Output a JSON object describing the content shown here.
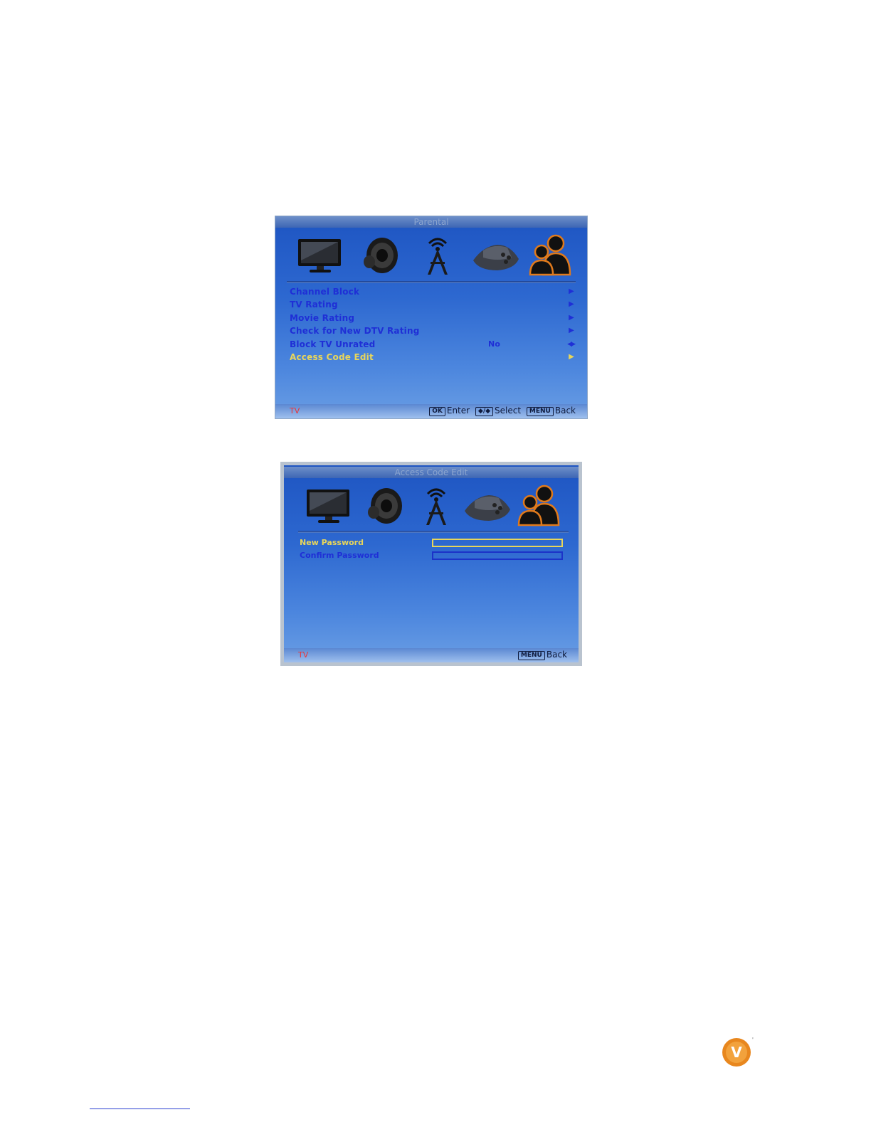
{
  "screen1": {
    "title": "Parental",
    "icons": [
      "tv-picture-icon",
      "speaker-audio-icon",
      "antenna-tower-icon",
      "settings-device-icon",
      "parental-users-icon"
    ],
    "active_icon": "parental-users-icon",
    "menu": [
      {
        "label": "Channel Block",
        "value": "",
        "control": "arrow"
      },
      {
        "label": "TV Rating",
        "value": "",
        "control": "arrow"
      },
      {
        "label": "Movie Rating",
        "value": "",
        "control": "arrow"
      },
      {
        "label": "Check for New DTV Rating",
        "value": "",
        "control": "arrow"
      },
      {
        "label": "Block TV Unrated",
        "value": "No",
        "control": "left-right"
      },
      {
        "label": "Access Code Edit",
        "value": "",
        "control": "arrow",
        "selected": true
      }
    ],
    "footer": {
      "source": "TV",
      "ok_key": "OK",
      "enter_label": "Enter",
      "nav_key": "◆/◆",
      "select_label": "Select",
      "menu_key": "MENU",
      "back_label": "Back"
    }
  },
  "screen2": {
    "title": "Access Code Edit",
    "icons": [
      "tv-picture-icon",
      "speaker-audio-icon",
      "antenna-tower-icon",
      "settings-device-icon",
      "parental-users-icon"
    ],
    "active_icon": "parental-users-icon",
    "fields": [
      {
        "label": "New Password",
        "value": "",
        "selected": true
      },
      {
        "label": "Confirm Password",
        "value": "",
        "selected": false
      }
    ],
    "footer": {
      "source": "TV",
      "menu_key": "MENU",
      "back_label": "Back"
    }
  },
  "colors": {
    "menu_text": "#1f2fd6",
    "selected_text": "#e8d65a",
    "source_text": "#e8373b",
    "active_icon_outline": "#e07a1c",
    "logo": "#e8871e"
  },
  "logo": {
    "letter": "V",
    "mark": "™"
  }
}
